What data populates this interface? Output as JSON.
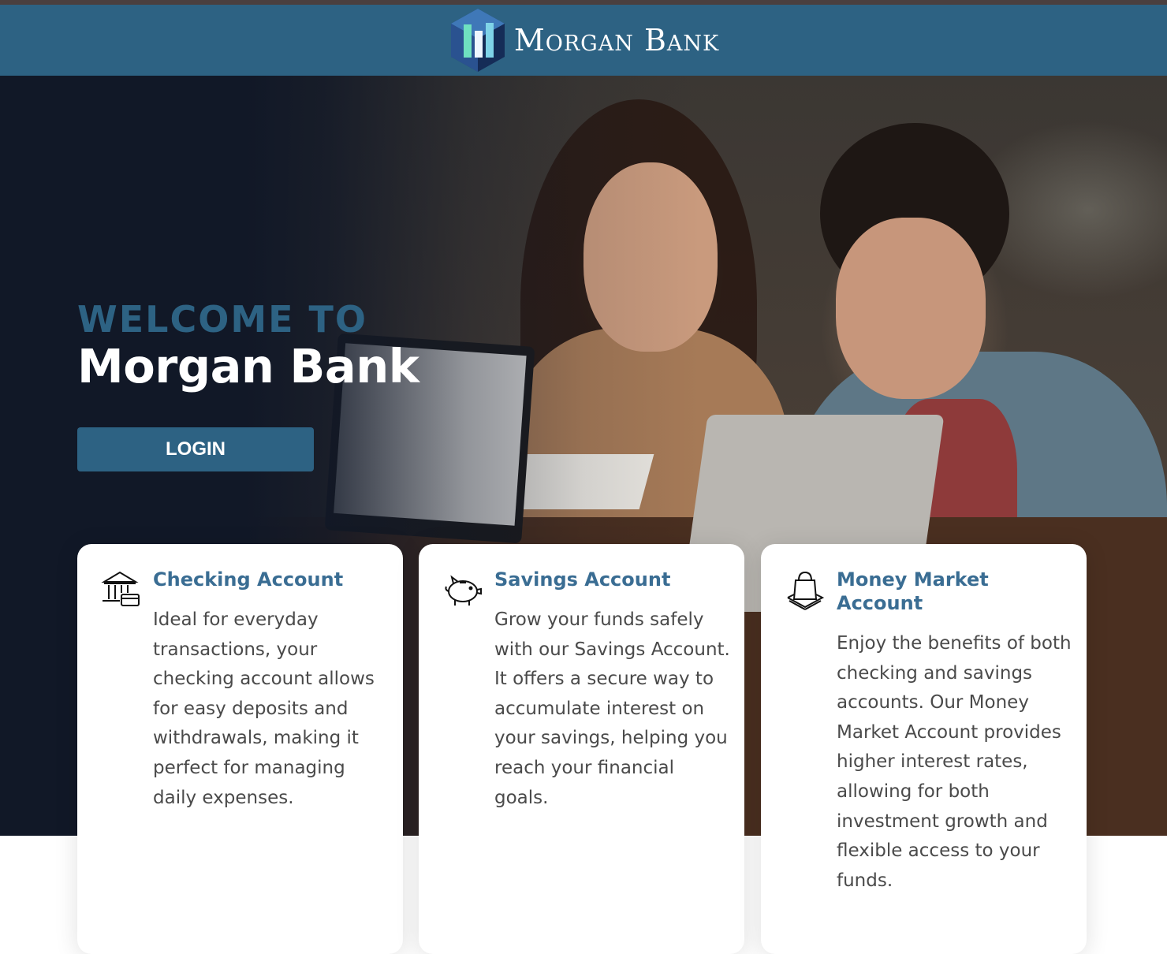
{
  "header": {
    "brand": "Morgan Bank"
  },
  "hero": {
    "welcome": "WELCOME TO",
    "bank_name": "Morgan Bank",
    "login_label": "LOGIN"
  },
  "cards": [
    {
      "title": "Checking Account",
      "body": "Ideal for everyday transactions, your checking account allows for easy deposits and withdrawals, making it perfect for managing daily expenses.",
      "icon": "bank-building-icon"
    },
    {
      "title": "Savings Account",
      "body": "Grow your funds safely with our Savings Account. It offers a secure way to accumulate interest on your savings, helping you reach your financial goals.",
      "icon": "piggy-bank-icon"
    },
    {
      "title": "Money Market Account",
      "body": "Enjoy the benefits of both checking and savings accounts. Our Money Market Account provides higher interest rates, allowing for both investment growth and flexible access to your funds.",
      "icon": "shopping-bag-icon"
    }
  ],
  "colors": {
    "primary": "#2d6283",
    "hero_dark": "#111827",
    "card_title": "#3a6d93",
    "body_text": "#4a4a4a"
  }
}
